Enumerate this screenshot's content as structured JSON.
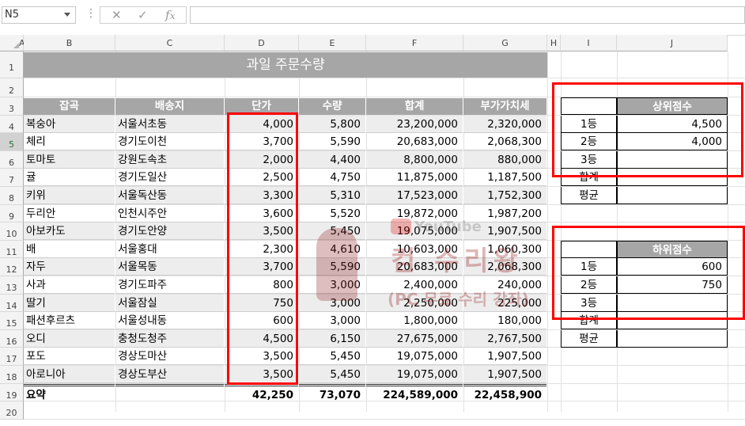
{
  "name_box": "N5",
  "formula_icons": [
    "cancel-icon",
    "enter-icon",
    "function-icon"
  ],
  "formula_text": "",
  "columns": [
    "A",
    "B",
    "C",
    "D",
    "E",
    "F",
    "G",
    "H",
    "I",
    "J"
  ],
  "rows": [
    "1",
    "2",
    "3",
    "4",
    "5",
    "6",
    "7",
    "8",
    "9",
    "10",
    "11",
    "12",
    "13",
    "14",
    "15",
    "16",
    "17",
    "18",
    "19",
    "20"
  ],
  "title": "과일 주문수량",
  "headers": [
    "잡곡",
    "배송지",
    "단가",
    "수량",
    "합계",
    "부가가치세"
  ],
  "data": [
    [
      "복숭아",
      "서울서초동",
      "4,000",
      "5,800",
      "23,200,000",
      "2,320,000"
    ],
    [
      "체리",
      "경기도이천",
      "3,700",
      "5,590",
      "20,683,000",
      "2,068,300"
    ],
    [
      "토마토",
      "강원도속초",
      "2,000",
      "4,400",
      "8,800,000",
      "880,000"
    ],
    [
      "귤",
      "경기도일산",
      "2,500",
      "4,750",
      "11,875,000",
      "1,187,500"
    ],
    [
      "키위",
      "서울독산동",
      "3,300",
      "5,310",
      "17,523,000",
      "1,752,300"
    ],
    [
      "두리안",
      "인천시주안",
      "3,600",
      "5,520",
      "19,872,000",
      "1,987,200"
    ],
    [
      "아보카도",
      "경기도안양",
      "3,500",
      "5,450",
      "19,075,000",
      "1,907,500"
    ],
    [
      "배",
      "서울홍대",
      "2,300",
      "4,610",
      "10,603,000",
      "1,060,300"
    ],
    [
      "자두",
      "서울목동",
      "3,700",
      "5,590",
      "20,683,000",
      "2,068,300"
    ],
    [
      "사과",
      "경기도파주",
      "800",
      "3,000",
      "2,400,000",
      "240,000"
    ],
    [
      "딸기",
      "서울잠실",
      "750",
      "3,000",
      "2,250,000",
      "225,000"
    ],
    [
      "패션후르츠",
      "서울성내동",
      "600",
      "3,000",
      "1,800,000",
      "180,000"
    ],
    [
      "오디",
      "충청도청주",
      "4,500",
      "6,150",
      "27,675,000",
      "2,767,500"
    ],
    [
      "포도",
      "경상도마산",
      "3,500",
      "5,450",
      "19,075,000",
      "1,907,500"
    ],
    [
      "아로니아",
      "경상도부산",
      "3,500",
      "5,450",
      "19,075,000",
      "1,907,500"
    ]
  ],
  "summary": [
    "요약",
    "",
    "42,250",
    "73,070",
    "224,589,000",
    "22,458,900"
  ],
  "top_table": {
    "header": "상위점수",
    "rows": [
      [
        "1등",
        "4,500"
      ],
      [
        "2등",
        "4,000"
      ],
      [
        "3등",
        ""
      ],
      [
        "합계",
        ""
      ],
      [
        "평균",
        ""
      ]
    ]
  },
  "bottom_table": {
    "header": "하위점수",
    "rows": [
      [
        "1등",
        "600"
      ],
      [
        "2등",
        "750"
      ],
      [
        "3등",
        ""
      ],
      [
        "합계",
        ""
      ],
      [
        "평균",
        ""
      ]
    ]
  },
  "watermark": {
    "line1": "YouTube",
    "line2": "컴 수리왕",
    "line3": "(PC 무료 수리 강좌)"
  },
  "colors": {
    "title_bg": "#a6a6a6",
    "header_bg": "#a6a6a6",
    "band_bg": "#ededed",
    "highlight": "#ff0000",
    "selected_row": "#d2d2d2"
  }
}
